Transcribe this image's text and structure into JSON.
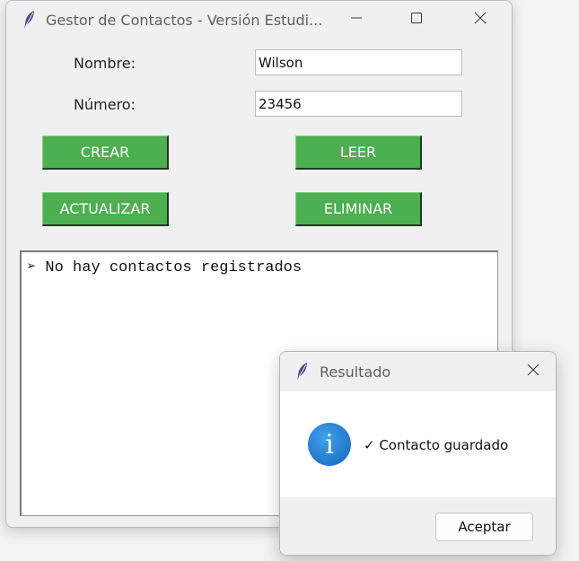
{
  "main_window": {
    "title": "Gestor de Contactos - Versión Estudi...",
    "labels": {
      "nombre": "Nombre:",
      "numero": "Número:"
    },
    "inputs": {
      "nombre_value": "Wilson",
      "numero_value": "23456"
    },
    "buttons": {
      "crear": "CREAR",
      "leer": "LEER",
      "actualizar": "ACTUALIZAR",
      "eliminar": "ELIMINAR"
    },
    "output": {
      "text": "➢ No hay contactos registrados"
    },
    "icons": {
      "app": "feather-icon",
      "minimize": "minimize-icon",
      "maximize": "maximize-icon",
      "close": "close-icon"
    }
  },
  "dialog": {
    "title": "Resultado",
    "message": "✓ Contacto guardado",
    "info_glyph": "i",
    "accept_label": "Aceptar",
    "icons": {
      "app": "feather-icon",
      "info": "info-icon",
      "close": "close-icon"
    }
  },
  "colors": {
    "button_green": "#4caf50",
    "info_blue": "#1976d2"
  }
}
